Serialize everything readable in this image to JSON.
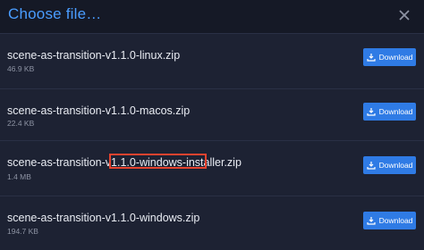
{
  "dialog": {
    "title": "Choose file…",
    "close_icon": "close-icon"
  },
  "files": [
    {
      "name": "scene-as-transition-v1.1.0-linux.zip",
      "size": "46.9 KB",
      "button_label": "Download"
    },
    {
      "name": "scene-as-transition-v1.1.0-macos.zip",
      "size": "22.4 KB",
      "button_label": "Download"
    },
    {
      "name": "scene-as-transition-v1.1.0-windows-installer.zip",
      "size": "1.4 MB",
      "button_label": "Download"
    },
    {
      "name": "scene-as-transition-v1.1.0-windows.zip",
      "size": "194.7 KB",
      "button_label": "Download"
    }
  ],
  "highlight": {
    "color": "#e5432f"
  },
  "colors": {
    "accent": "#4a9dff",
    "button": "#2f7be5",
    "background": "#1d2233"
  }
}
